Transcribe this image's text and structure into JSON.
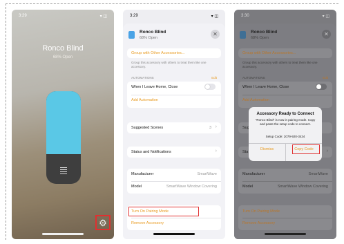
{
  "accessory": {
    "name": "Ronco Blind",
    "status": "68% Open"
  },
  "phone1": {
    "time": "3:29",
    "indicators": "▾ ◫",
    "blind_level": 0.68
  },
  "phone2": {
    "time": "3:29",
    "indicators": "▾ ◫"
  },
  "phone3": {
    "time": "3:30",
    "indicators": "▾ ◫"
  },
  "settings": {
    "group_link": "Group with Other Accessories...",
    "group_desc": "Group this accessory with others to treat them like one accessory.",
    "automations_title": "AUTOMATIONS",
    "edit_label": "Edit",
    "automation_item": "When I Leave Home, Close",
    "add_automation": "Add Automation",
    "suggested_scenes": "Suggested Scenes",
    "suggested_scenes_count": "3",
    "status_notifications": "Status and Notifications",
    "manufacturer_label": "Manufacturer",
    "manufacturer_value": "SmartWave",
    "model_label": "Model",
    "model_value": "SmartWave Window Covering",
    "pairing_mode": "Turn On Pairing Mode",
    "remove_accessory": "Remove Accessory"
  },
  "phone3_partial": {
    "group_link": "Group with Other Accessories...",
    "group_desc": "Group this accessory with others to treat them like one accessory.",
    "automations_title": "AUTOMATIONS",
    "edit_label": "Edit",
    "automation_item": "When I Leave Home, Close",
    "add_automation": "Add Automation",
    "suggested_cut": "Sug",
    "status_cut": "Sta",
    "manufacturer_label": "Manufacturer",
    "manufacturer_value": "SmartWave",
    "model_label": "Model",
    "model_value": "SmartWave Window Covering",
    "pairing_mode": "Turn On Pairing Mode",
    "remove_accessory": "Remove Accessory"
  },
  "alert": {
    "title": "Accessory Ready to Connect",
    "message": "\"Ronco Blind\" is now in pairing mode. Copy and paste the setup code to connect.",
    "setup_code": "Setup Code: 2079-920-3434",
    "dismiss": "Dismiss",
    "copy_code": "Copy Code"
  }
}
